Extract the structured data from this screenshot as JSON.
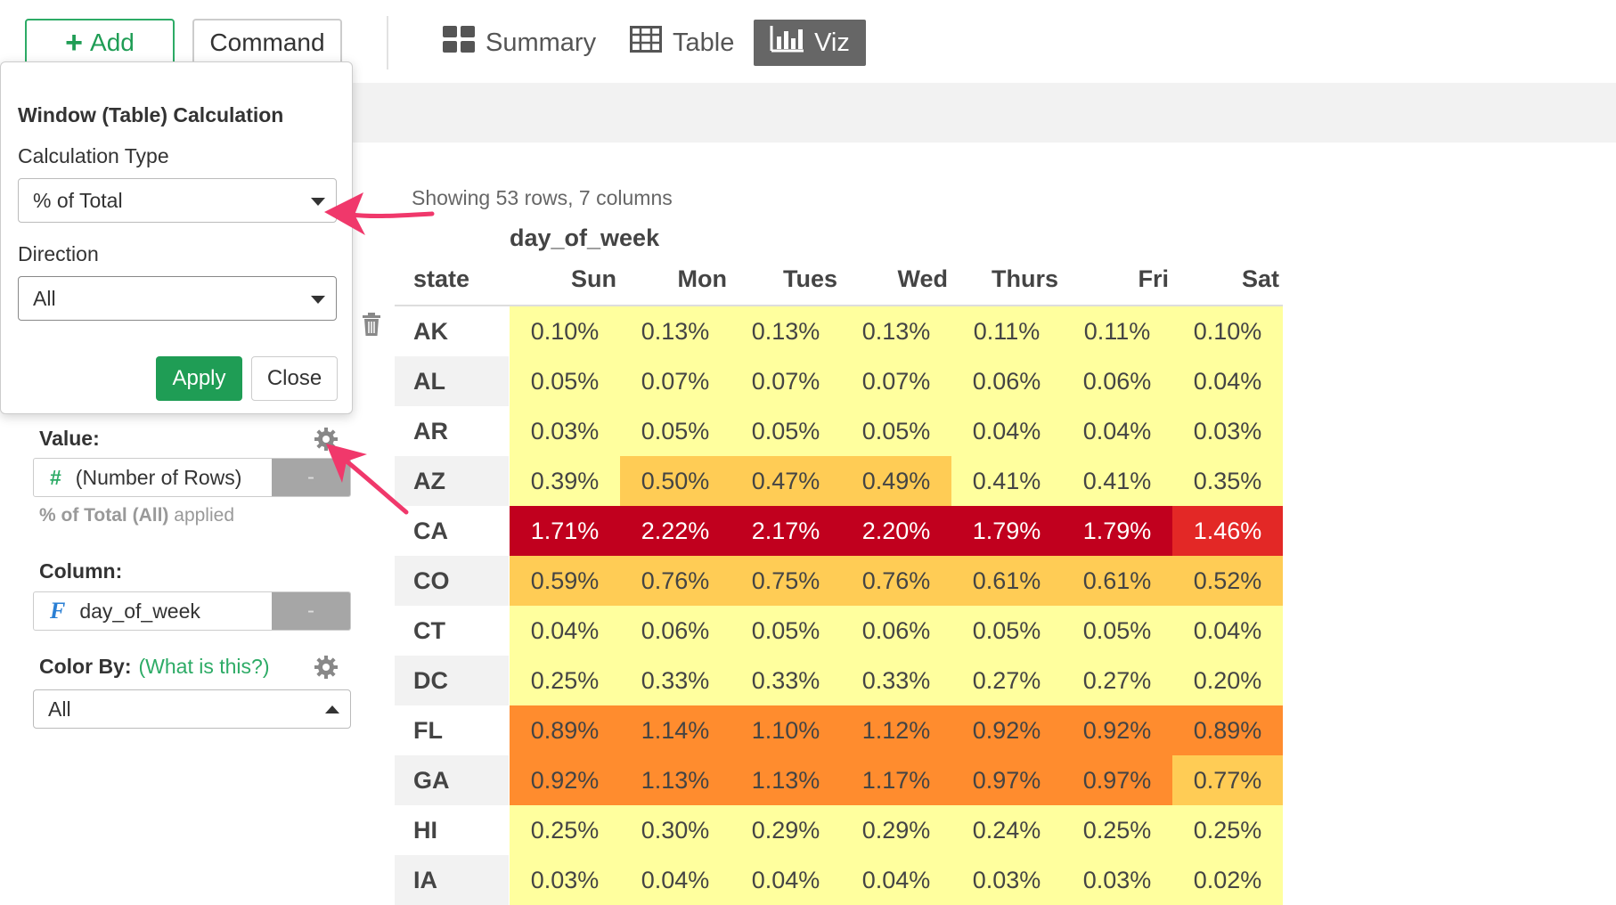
{
  "toolbar": {
    "add_label": "Add",
    "command_label": "Command",
    "tabs": [
      {
        "label": "Summary",
        "icon": "summary-grid-icon"
      },
      {
        "label": "Table",
        "icon": "table-icon"
      },
      {
        "label": "Viz",
        "icon": "bar-chart-icon",
        "active": true
      }
    ]
  },
  "popover": {
    "title": "Window (Table) Calculation",
    "calc_type_label": "Calculation Type",
    "calc_type_value": "% of Total",
    "direction_label": "Direction",
    "direction_value": "All",
    "apply_label": "Apply",
    "close_label": "Close"
  },
  "sidebar": {
    "value_label": "Value:",
    "value_field": "(Number of Rows)",
    "value_symbol": "#",
    "value_remove": "-",
    "applied_bold": "% of Total (All)",
    "applied_text": "applied",
    "column_label": "Column:",
    "column_field": "day_of_week",
    "column_symbol": "F",
    "column_remove": "-",
    "colorby_label": "Color By:",
    "colorby_link": "(What is this?)",
    "colorby_value": "All"
  },
  "table": {
    "showing": "Showing 53 rows, 7 columns",
    "pivot_header": "day_of_week",
    "row_header": "state",
    "columns": [
      "Sun",
      "Mon",
      "Tues",
      "Wed",
      "Thurs",
      "Fri",
      "Sat"
    ],
    "rows": [
      {
        "state": "AK",
        "values": [
          "0.10%",
          "0.13%",
          "0.13%",
          "0.13%",
          "0.11%",
          "0.11%",
          "0.10%"
        ]
      },
      {
        "state": "AL",
        "values": [
          "0.05%",
          "0.07%",
          "0.07%",
          "0.07%",
          "0.06%",
          "0.06%",
          "0.04%"
        ]
      },
      {
        "state": "AR",
        "values": [
          "0.03%",
          "0.05%",
          "0.05%",
          "0.05%",
          "0.04%",
          "0.04%",
          "0.03%"
        ]
      },
      {
        "state": "AZ",
        "values": [
          "0.39%",
          "0.50%",
          "0.47%",
          "0.49%",
          "0.41%",
          "0.41%",
          "0.35%"
        ]
      },
      {
        "state": "CA",
        "values": [
          "1.71%",
          "2.22%",
          "2.17%",
          "2.20%",
          "1.79%",
          "1.79%",
          "1.46%"
        ]
      },
      {
        "state": "CO",
        "values": [
          "0.59%",
          "0.76%",
          "0.75%",
          "0.76%",
          "0.61%",
          "0.61%",
          "0.52%"
        ]
      },
      {
        "state": "CT",
        "values": [
          "0.04%",
          "0.06%",
          "0.05%",
          "0.06%",
          "0.05%",
          "0.05%",
          "0.04%"
        ]
      },
      {
        "state": "DC",
        "values": [
          "0.25%",
          "0.33%",
          "0.33%",
          "0.33%",
          "0.27%",
          "0.27%",
          "0.20%"
        ]
      },
      {
        "state": "FL",
        "values": [
          "0.89%",
          "1.14%",
          "1.10%",
          "1.12%",
          "0.92%",
          "0.92%",
          "0.89%"
        ]
      },
      {
        "state": "GA",
        "values": [
          "0.92%",
          "1.13%",
          "1.13%",
          "1.17%",
          "0.97%",
          "0.97%",
          "0.77%"
        ]
      },
      {
        "state": "HI",
        "values": [
          "0.25%",
          "0.30%",
          "0.29%",
          "0.29%",
          "0.24%",
          "0.25%",
          "0.25%"
        ]
      },
      {
        "state": "IA",
        "values": [
          "0.03%",
          "0.04%",
          "0.04%",
          "0.04%",
          "0.03%",
          "0.03%",
          "0.02%"
        ]
      }
    ]
  },
  "colors": {
    "accent_green": "#1f9d55",
    "heat_low": "#ffff9e",
    "heat_mid": "#ffcc55",
    "heat_high": "#ff8c2e",
    "heat_top": "#c1001e",
    "heat_top_edge": "#e32826",
    "annotation_arrow": "#f0386b"
  }
}
